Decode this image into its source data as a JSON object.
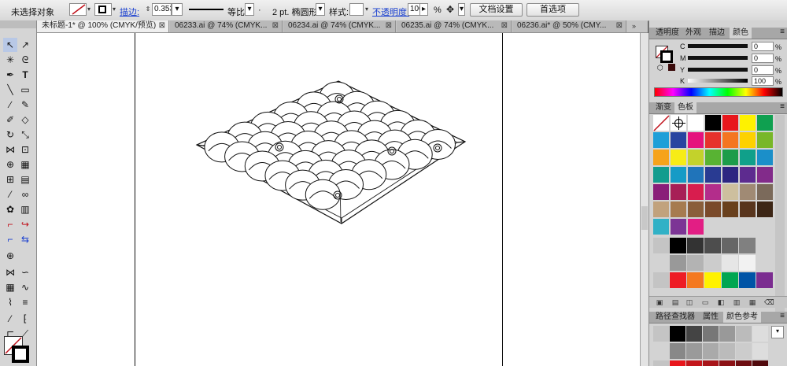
{
  "control_bar": {
    "selection_status": "未选择对象",
    "stroke_label": "描边:",
    "stroke_weight": "0.353",
    "stroke_profile": "等比",
    "brush_def": "2 pt. 椭圆形",
    "style_label": "样式:",
    "opacity_label": "不透明度:",
    "opacity_value": "100",
    "opacity_unit": "%",
    "doc_setup_button": "文档设置",
    "preferences_button": "首选项"
  },
  "tabs": [
    {
      "label": "未标题-1* @ 100% (CMYK/预览)"
    },
    {
      "label": "06233.ai @ 74% (CMYK..."
    },
    {
      "label": "06234.ai @ 74% (CMYK..."
    },
    {
      "label": "06235.ai @ 74% (CMYK..."
    },
    {
      "label": "06236.ai* @ 50% (CMY..."
    }
  ],
  "color_panel": {
    "tabs": [
      "透明度",
      "外观",
      "描边",
      "颜色"
    ],
    "sliders": [
      {
        "label": "C",
        "value": "0"
      },
      {
        "label": "M",
        "value": "0"
      },
      {
        "label": "Y",
        "value": "0"
      },
      {
        "label": "K",
        "value": "100"
      }
    ],
    "units": [
      "%",
      "%",
      "%",
      "%"
    ]
  },
  "swatches_panel": {
    "tabs": [
      "渐变",
      "色板"
    ],
    "swatches": [
      "#ffffff",
      "#ffffff",
      "#ffffff",
      "#000000",
      "#e8161c",
      "#fef200",
      "#0fa050",
      "#1e9fd8",
      "#2844a0",
      "#e5117d",
      "#e6322c",
      "#f47621",
      "#fdd100",
      "#78b728",
      "#f6a31b",
      "#f7ec16",
      "#c3d22b",
      "#58b333",
      "#1d9c4a",
      "#10a08a",
      "#1b8fc9",
      "#129c8e",
      "#159bc6",
      "#2074ba",
      "#293b92",
      "#2d2681",
      "#5d2b8f",
      "#822b8a",
      "#8a1e78",
      "#a71f56",
      "#d81d4e",
      "#b32d8b",
      "#cdbf9e",
      "#a08a74",
      "#7b6a5b",
      "#c1a27d",
      "#a67b4f",
      "#8a5e3a",
      "#7a4a2a",
      "#69401d",
      "#59351d",
      "#3d2616",
      "#31b1c6",
      "#7c3595",
      "#e21e84"
    ],
    "gray_row_1": [
      "#000000",
      "#333333",
      "#4d4d4d",
      "#666666",
      "#808080"
    ],
    "gray_row_2": [
      "#999999",
      "#b3b3b3",
      "#cccccc",
      "#e6e6e6",
      "#f2f2f2"
    ],
    "bright_row": [
      "#ee1c25",
      "#f47920",
      "#fff200",
      "#00a651",
      "#0054a6",
      "#7b2c90"
    ]
  },
  "bottom_panel": {
    "tabs": [
      "路径查找器",
      "属性",
      "颜色参考"
    ],
    "row_a": [
      "#000000",
      "#444444",
      "#777777",
      "#999999",
      "#bbbbbb",
      "#dddddd"
    ],
    "row_b": [
      "#888888",
      "#9a9a9a",
      "#aaaaaa",
      "#bbbbbb",
      "#cccccc",
      "#dddddd"
    ],
    "row_c": [
      "#e8161c",
      "#c3161b",
      "#a8151a",
      "#8c1216",
      "#6e0e12",
      "#510a0d"
    ]
  },
  "colors": {
    "stroke_accent": "#c0101a",
    "link_blue": "#1a40d0"
  }
}
